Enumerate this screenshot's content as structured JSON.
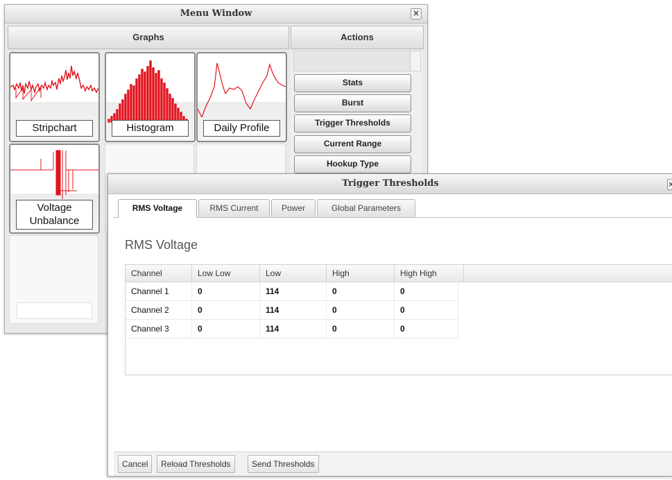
{
  "menu_window": {
    "title": "Menu Window",
    "close_glyph": "×",
    "graphs_header": "Graphs",
    "actions_header": "Actions",
    "tiles": [
      {
        "label": "Stripchart",
        "icon": "stripchart-thumbnail"
      },
      {
        "label": "Histogram",
        "icon": "histogram-thumbnail"
      },
      {
        "label": "Daily Profile",
        "icon": "daily-profile-thumbnail"
      },
      {
        "label_line1": "Voltage",
        "label_line2": "Unbalance",
        "icon": "voltage-unbalance-thumbnail"
      }
    ],
    "actions": [
      "Stats",
      "Burst",
      "Trigger Thresholds",
      "Current Range",
      "Hookup Type"
    ]
  },
  "trigger_window": {
    "title": "Trigger Thresholds",
    "close_glyph": "×",
    "tabs": [
      "RMS Voltage",
      "RMS Current",
      "Power",
      "Global Parameters"
    ],
    "active_tab": "RMS Voltage",
    "section_title": "RMS Voltage",
    "columns": [
      "Channel",
      "Low Low",
      "Low",
      "High",
      "High High"
    ],
    "rows": [
      [
        "Channel 1",
        "0",
        "114",
        "0",
        "0"
      ],
      [
        "Channel 2",
        "0",
        "114",
        "0",
        "0"
      ],
      [
        "Channel 3",
        "0",
        "114",
        "0",
        "0"
      ]
    ],
    "buttons": [
      "Cancel",
      "Reload Thresholds",
      "Send Thresholds"
    ]
  },
  "colors": {
    "accent_red": "#e0141e"
  }
}
